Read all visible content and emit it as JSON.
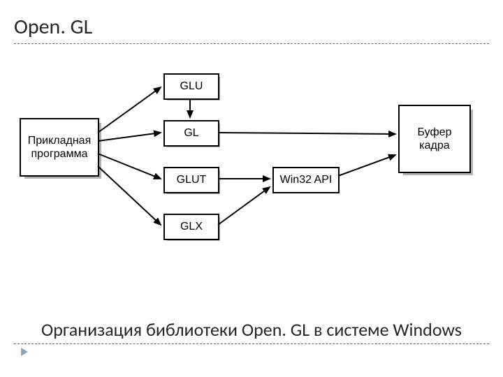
{
  "title": "Open. GL",
  "caption": "Организация библиотеки Open. GL в системе Windows",
  "boxes": {
    "app": "Прикладная\nпрограмма",
    "glu": "GLU",
    "gl": "GL",
    "glut": "GLUT",
    "glx": "GLX",
    "win32": "Win32 API",
    "frame": "Буфер\nкадра"
  }
}
